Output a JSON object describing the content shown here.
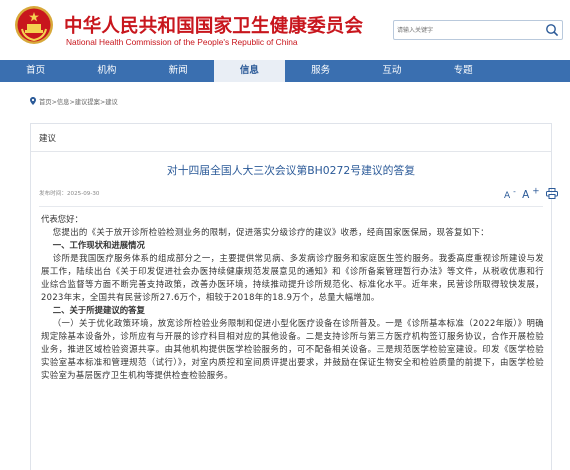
{
  "header": {
    "title_cn": "中华人民共和国国家卫生健康委员会",
    "title_en": "National Health Commission of the People's Republic of China",
    "search_placeholder": "请输入关键字",
    "emblem_icon": "national-emblem-icon",
    "search_icon": "search-icon",
    "brand_red": "#c8161d"
  },
  "nav": {
    "items": [
      "首页",
      "机构",
      "新闻",
      "信息",
      "服务",
      "互动",
      "专题"
    ],
    "active": "信息",
    "bg_color": "#3a6fb0"
  },
  "breadcrumb": {
    "home": "首页",
    "sep": ">",
    "info": "信息",
    "advice": "建议提案",
    "current": "建议"
  },
  "panel": {
    "tab_label": "建议"
  },
  "article": {
    "title": "对十四届全国人大三次会议第BH0272号建议的答复",
    "date_label": "发布时间：",
    "date": "2025-09-30",
    "font_small": "A",
    "font_big": "A",
    "sup_minus": "-",
    "sup_plus": "+",
    "print_icon": "print-icon",
    "salutation": "代表您好：",
    "intro": "您提出的《关于放开诊所检验检测业务的限制，促进落实分级诊疗的建议》收悉，经商国家医保局，现答复如下：",
    "section1_heading": "一、工作现状和进展情况",
    "section1_body": "诊所是我国医疗服务体系的组成部分之一，主要提供常见病、多发病诊疗服务和家庭医生签约服务。我委高度重视诊所建设与发展工作，陆续出台《关于印发促进社会办医持续健康规范发展意见的通知》和《诊所备案管理暂行办法》等文件，从税收优惠和行业综合监督等方面不断完善支持政策，改善办医环境，持续推动提升诊所规范化、标准化水平。近年来，民营诊所取得较快发展，2023年末，全国共有民营诊所27.6万个，相较于2018年的18.9万个，总量大幅增加。",
    "section2_heading": "二、关于所提建议的答复",
    "section2_body": "（一）关于优化政策环境，放宽诊所检验业务限制和促进小型化医疗设备在诊所普及。一是《诊所基本标准（2022年版）》明确规定除基本设备外，诊所应有与开展的诊疗科目相对应的其他设备。二是支持诊所与第三方医疗机构签订服务协议，合作开展检验业务，推进区域检验资源共享。由其他机构提供医学检验服务的，可不配备相关设备。三是规范医学检验室建设。印发《医学检验实验室基本标准和管理规范（试行）》，对室内质控和室间质评提出要求，并鼓励在保证生物安全和检验质量的前提下，由医学检验实验室为基层医疗卫生机构等提供检查检验服务。"
  }
}
